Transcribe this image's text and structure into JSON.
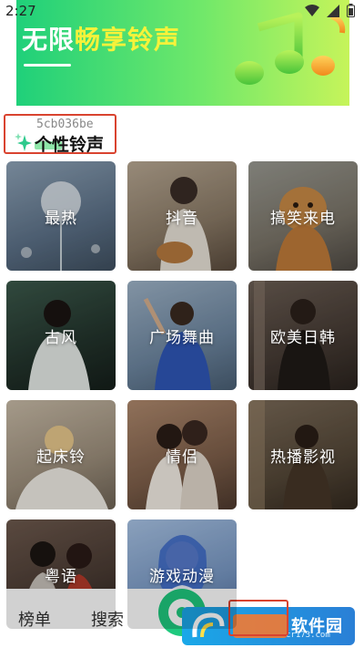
{
  "status_bar": {
    "time": "2:27"
  },
  "banner": {
    "title_white": "无限",
    "title_yellow": "畅享铃声"
  },
  "section": {
    "hash": "5cb036be",
    "title": "个性铃声"
  },
  "categories": [
    {
      "label": "最热"
    },
    {
      "label": "抖音"
    },
    {
      "label": "搞笑来电"
    },
    {
      "label": "古风"
    },
    {
      "label": "广场舞曲"
    },
    {
      "label": "欧美日韩"
    },
    {
      "label": "起床铃"
    },
    {
      "label": "情侣"
    },
    {
      "label": "热播影视"
    },
    {
      "label": "粤语"
    },
    {
      "label": "游戏动漫"
    }
  ],
  "bottom_nav": {
    "tab1": "榜单",
    "tab2": "搜索"
  },
  "watermark": {
    "text": "软件园",
    "url": "cr173.com"
  },
  "colors": {
    "accent": "#1fc97e",
    "highlight_box": "#d9432f"
  }
}
